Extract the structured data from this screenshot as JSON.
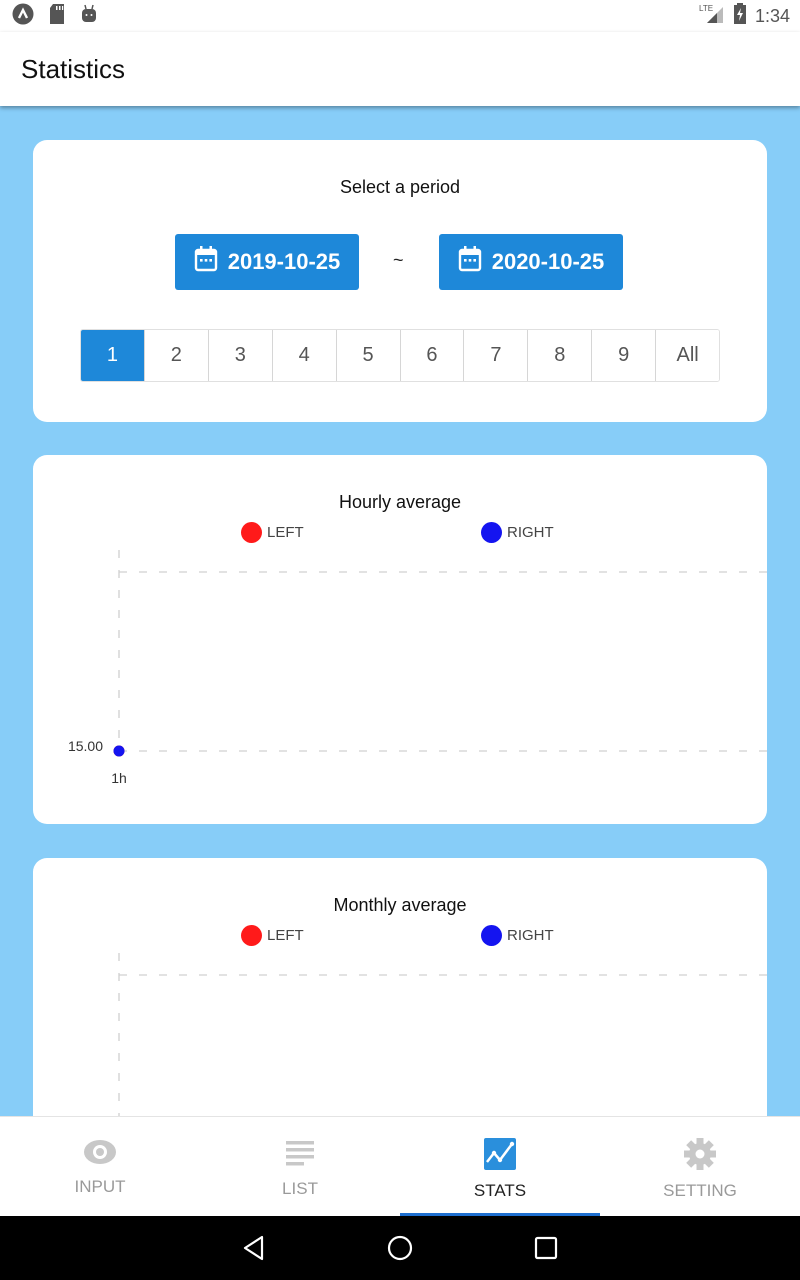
{
  "status_bar": {
    "time": "1:34",
    "network": "LTE",
    "left_icons": [
      "app-notification-icon",
      "sd-card-icon",
      "android-debug-icon"
    ],
    "right_icons": [
      "lte-signal-icon",
      "battery-charging-icon"
    ]
  },
  "app_bar": {
    "title": "Statistics"
  },
  "period": {
    "title": "Select a period",
    "start_date": "2019-10-25",
    "end_date": "2020-10-25",
    "separator": "~",
    "segments": [
      "1",
      "2",
      "3",
      "4",
      "5",
      "6",
      "7",
      "8",
      "9",
      "All"
    ],
    "selected_segment": "1"
  },
  "colors": {
    "accent": "#1e88d9",
    "background": "#87cdf8",
    "left_series": "#ff1a1a",
    "right_series": "#1414f0"
  },
  "chart_data": [
    {
      "type": "scatter",
      "title": "Hourly average",
      "legend": [
        "LEFT",
        "RIGHT"
      ],
      "legend_position": "top",
      "x_ticks": [
        "1h"
      ],
      "y_ticks": [
        "15.00"
      ],
      "grid": true,
      "series": [
        {
          "name": "LEFT",
          "color": "#ff1a1a",
          "points": [
            {
              "x": "1h",
              "y": 15.0
            }
          ]
        },
        {
          "name": "RIGHT",
          "color": "#1414f0",
          "points": [
            {
              "x": "1h",
              "y": 15.0
            }
          ]
        }
      ]
    },
    {
      "type": "scatter",
      "title": "Monthly average",
      "legend": [
        "LEFT",
        "RIGHT"
      ],
      "legend_position": "top",
      "x_ticks": [],
      "y_ticks": [],
      "grid": true,
      "series": [
        {
          "name": "LEFT",
          "color": "#ff1a1a",
          "points": []
        },
        {
          "name": "RIGHT",
          "color": "#1414f0",
          "points": []
        }
      ]
    }
  ],
  "bottom_nav": {
    "items": [
      {
        "label": "INPUT",
        "icon": "eye-icon",
        "active": false
      },
      {
        "label": "LIST",
        "icon": "list-icon",
        "active": false
      },
      {
        "label": "STATS",
        "icon": "chart-icon",
        "active": true
      },
      {
        "label": "SETTING",
        "icon": "gear-icon",
        "active": false
      }
    ]
  },
  "system_nav": [
    "back-icon",
    "home-icon",
    "recents-icon"
  ]
}
